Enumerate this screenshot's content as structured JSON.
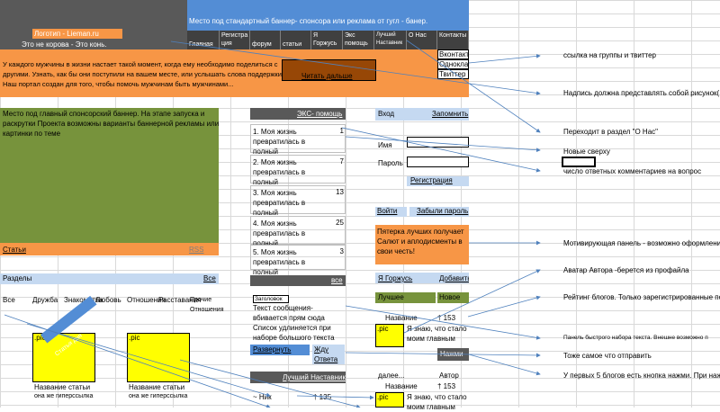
{
  "header": {
    "banner_top": "Место под стандартный баннер- спонсора или реклама от гугл - банер.",
    "logo": "Логотип - Lieman.ru",
    "slogan": "Это не корова - Это конь.",
    "nav": [
      {
        "label": "Главная"
      },
      {
        "label": "Регистра ция"
      },
      {
        "label": "форум"
      },
      {
        "label": "статьи"
      },
      {
        "label": "Я Горжусь"
      },
      {
        "label": "Экс помощь"
      },
      {
        "label": "Лучший Наставник"
      },
      {
        "label": "О Нас"
      },
      {
        "label": "Контакты"
      }
    ],
    "social": [
      "Вконтакте",
      "Одноклассники",
      "Твиттер"
    ]
  },
  "intro": {
    "text": "У каждого мужчины в жизни настает такой момент, когда ему необходимо поделиться с другими. Узнать, как бы они поступили на вашем месте, или услышать слова поддержки. Наш портал создан для того, чтобы помочь мужчинам быть мужчинами...",
    "read_more": "Читать дальше"
  },
  "main_banner": {
    "text": "Место под главный спонсорский баннер. На этапе запуска и раскрутки Проекта возможны варианты баннерной рекламы или картинки по теме",
    "articles": "Статьи",
    "rss": "RSS"
  },
  "sections": {
    "title": "Разделы",
    "all": "Все",
    "tabs": [
      "Все",
      "Дружба",
      "Знакомства",
      "Любовь",
      "Отношения",
      "Расставания",
      "Прочие Отношения"
    ],
    "cards": [
      {
        "pic": ".pic",
        "title": "Название статьи",
        "sub": "она же гиперссылка"
      },
      {
        "pic": ".pic",
        "title": "Название статьи",
        "sub": "она же гиперссылка"
      }
    ],
    "diag_label": "Статья дня"
  },
  "help": {
    "title": "ЭКС- помощь",
    "items": [
      {
        "text": "1. Моя жизнь превратилась в полный",
        "count": "1"
      },
      {
        "text": "2. Моя жизнь превратилась в полный",
        "count": "7"
      },
      {
        "text": "3. Моя жизнь превратилась в полный",
        "count": "13"
      },
      {
        "text": "4. Моя жизнь превратилась в полный",
        "count": "25"
      },
      {
        "text": "5. Моя жизнь превратилась в полный",
        "count": "3"
      }
    ],
    "all": "все",
    "subject_label": "Заголовок",
    "message": "Текст сообщения- вбивается прям сюда Список удлиняется при наборе большого текста",
    "expand": "Развернуть",
    "wait": "Жду Ответа"
  },
  "mentor": {
    "title": "Лучший Наставник",
    "nick": "~ Ник",
    "rating": "† 135"
  },
  "login": {
    "title": "Вход",
    "remember": "Запомнить",
    "name": "Имя",
    "password": "Пароль",
    "register": "Регистрация",
    "enter": "Войти",
    "forgot": "Забыли пароль"
  },
  "motivation": {
    "text": "Пятерка лучших получает Салют и аплодисменты в свои честь!"
  },
  "proud": {
    "title": "Я Горжусь",
    "add": "Добавить",
    "best": "Лучшее",
    "new": "Новое",
    "item_title": "Название",
    "item_rating": "† 153",
    "pic": ".pic",
    "item_text": "Я знаю, что стало моим главным",
    "press": "Нажми",
    "more": "далее...",
    "author": "Автор",
    "item2_title": "Название",
    "item2_rating": "† 153",
    "item2_text": "Я знаю, что стало моим главным"
  },
  "annotations": [
    "ссылка на группы и твиттер",
    "Надпись должна представлять собой рисунок( т",
    "Переходит в раздел \"О Нас\"",
    "Новые сверху",
    "число ответных комментариев на вопрос",
    "Мотивирующая панель - возможно оформление",
    "Аватар Автора -берется из профайла",
    "Рейтинг блогов. Только зарегистрированные по",
    "Панель быстрого набора текста. Внешне возможно п",
    "Тоже самое что отправить",
    "У первых 5 блогов есть кнопка нажми. При нажа"
  ]
}
